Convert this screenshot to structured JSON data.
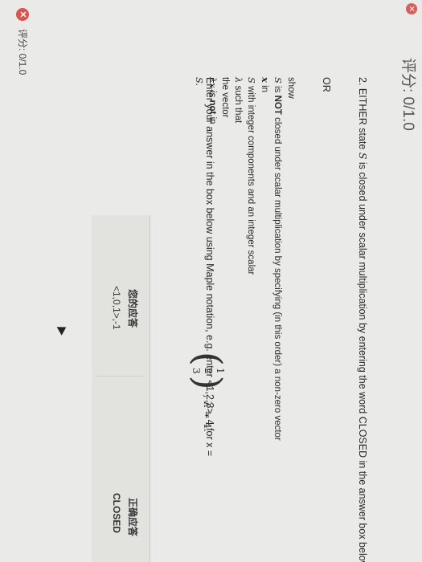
{
  "header": {
    "score": "评分: 0/1.0"
  },
  "question": {
    "number": "2.",
    "text_a": "EITHER state",
    "set_symbol": "S",
    "text_b": "is closed under scalar multiplication by entering the word CLOSED in the answer box below",
    "or_label": "OR",
    "show_label": "show",
    "line1_a": "is",
    "line1_bold": "NOT",
    "line1_b": "closed under scalar multiplication by specifying (in this order) a non-zero vector",
    "line2_sym": "x",
    "line2": "in",
    "line3": "with integer components and an integer scalar",
    "line4_sym": "λ",
    "line4": "such that",
    "line5": "the vector",
    "line6_sym": "λx",
    "line6_a": "is",
    "line6_bold": "not",
    "line6_b": "in",
    "line7_sym": "S."
  },
  "instruction": {
    "text": "Enter your answer in the box below using Maple notation, e.g. enter <1,2,3>, 4  for  x =",
    "vector": [
      "1",
      "2",
      "3"
    ],
    "lambda_text": ", λ = 4."
  },
  "answers": {
    "your_label": "您的应答",
    "your_value": "<1,0,1>,-1",
    "correct_label": "正确应答",
    "correct_value": "CLOSED"
  },
  "footer": {
    "score": "评分: 0/1.0"
  },
  "colors": {
    "wrong": "#d9534f",
    "background": "#eaeae8"
  }
}
